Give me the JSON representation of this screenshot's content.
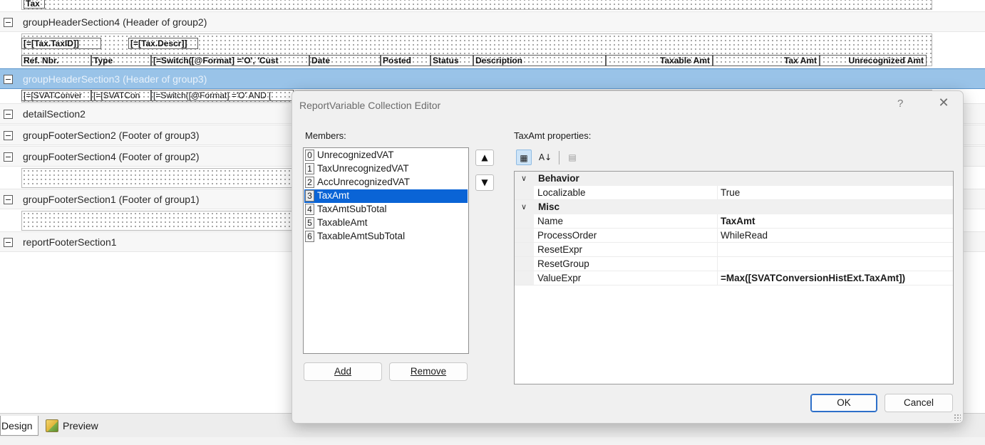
{
  "designer": {
    "top_field": "Tax",
    "bands": {
      "gh4": "groupHeaderSection4 (Header of group2)",
      "gh3": "groupHeaderSection3 (Header of group3)",
      "detail2": "detailSection2",
      "gf2": "groupFooterSection2 (Footer of group3)",
      "gf4": "groupFooterSection4 (Footer of group2)",
      "gf1": "groupFooterSection1 (Footer of group1)",
      "rf1": "reportFooterSection1"
    },
    "gh4_row1": [
      "[=[Tax.TaxID]]",
      "[=[Tax.Descr]]"
    ],
    "gh4_row2": [
      "Ref. Nbr.",
      "Type",
      "[=Switch([@Format] ='O', 'Cust",
      "Date",
      "Posted",
      "Status",
      "Description",
      "Taxable Amt",
      "Tax Amt",
      "Unrecognized Amt"
    ],
    "gh3_row": [
      "[=[SVATConver",
      "[=[SVATCon",
      "[=Switch([@Format] ='O' AND ["
    ]
  },
  "tabs": {
    "design": "Design",
    "preview": "Preview"
  },
  "dialog": {
    "title": "ReportVariable Collection Editor",
    "help": "?",
    "close": "✕",
    "members_label": "Members:",
    "members": [
      {
        "index": "0",
        "name": "UnrecognizedVAT"
      },
      {
        "index": "1",
        "name": "TaxUnrecognizedVAT"
      },
      {
        "index": "2",
        "name": "AccUnrecognizedVAT"
      },
      {
        "index": "3",
        "name": "TaxAmt"
      },
      {
        "index": "4",
        "name": "TaxAmtSubTotal"
      },
      {
        "index": "5",
        "name": "TaxableAmt"
      },
      {
        "index": "6",
        "name": "TaxableAmtSubTotal"
      }
    ],
    "selected_member_index": 3,
    "add_label": "Add",
    "remove_label": "Remove",
    "properties_label": "TaxAmt properties:",
    "categories": {
      "behavior": "Behavior",
      "misc": "Misc"
    },
    "properties": {
      "localizable": {
        "name": "Localizable",
        "value": "True"
      },
      "name": {
        "name": "Name",
        "value": "TaxAmt"
      },
      "process_order": {
        "name": "ProcessOrder",
        "value": "WhileRead"
      },
      "reset_expr": {
        "name": "ResetExpr",
        "value": ""
      },
      "reset_group": {
        "name": "ResetGroup",
        "value": ""
      },
      "value_expr": {
        "name": "ValueExpr",
        "value": "=Max([SVATConversionHistExt.TaxAmt])"
      }
    },
    "ok_label": "OK",
    "cancel_label": "Cancel"
  },
  "colors": {
    "selected_band": "#99c3e8",
    "list_selection": "#0a64d6",
    "primary_border": "#2d6fc9"
  }
}
